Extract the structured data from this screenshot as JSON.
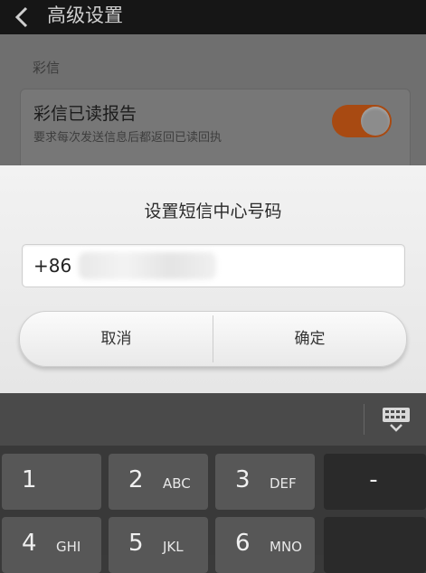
{
  "topbar": {
    "title": "高级设置"
  },
  "settings": {
    "section_label": "彩信",
    "pref": {
      "title": "彩信已读报告",
      "subtitle": "要求每次发送信息后都返回已读回执",
      "toggle_state": "on"
    }
  },
  "dialog": {
    "title": "设置短信中心号码",
    "input_value": "+86",
    "cancel_label": "取消",
    "ok_label": "确定"
  },
  "keyboard": {
    "keys": [
      {
        "num": "1",
        "letters": ""
      },
      {
        "num": "2",
        "letters": "ABC"
      },
      {
        "num": "3",
        "letters": "DEF"
      },
      {
        "sym": "-"
      },
      {
        "num": "4",
        "letters": "GHI"
      },
      {
        "num": "5",
        "letters": "JKL"
      },
      {
        "num": "6",
        "letters": "MNO"
      },
      {
        "sym": ""
      }
    ]
  },
  "colors": {
    "accent_toggle": "#a84a12",
    "dialog_bg": "#f0f0f0",
    "keyboard_bg": "#393939",
    "key_bg": "#575757"
  },
  "icons": {
    "back": "chevron-left-icon",
    "hide_keyboard": "keyboard-hide-icon"
  }
}
